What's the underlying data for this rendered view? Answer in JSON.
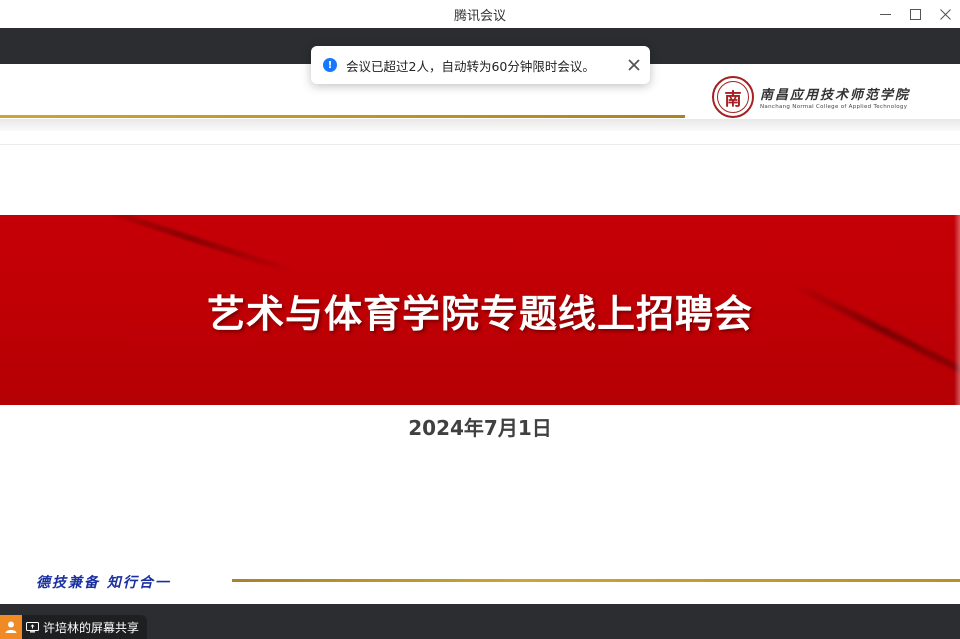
{
  "window": {
    "title": "腾讯会议",
    "controls": {
      "minimize": "—",
      "maximize": "☐",
      "close": "✕"
    }
  },
  "notification": {
    "icon": "info-icon",
    "icon_glyph": "!",
    "text": "会议已超过2人，自动转为60分钟限时会议。",
    "close": "✕"
  },
  "slide": {
    "logo": {
      "seal_char": "南",
      "name_cn": "南昌应用技术师范学院",
      "name_en": "Nanchang Normal College of Applied Technology"
    },
    "title": "艺术与体育学院专题线上招聘会",
    "date": "2024年7月1日",
    "motto": "德技兼备 知行合一"
  },
  "share_indicator": {
    "label": "许培林的屏幕共享"
  },
  "colors": {
    "banner_red": "#c00005",
    "gold": "#c9a53a",
    "motto_blue": "#1a2fa0",
    "toolbar_dark": "#2b2d30",
    "info_blue": "#1677ff",
    "avatar_orange": "#f08a24"
  }
}
